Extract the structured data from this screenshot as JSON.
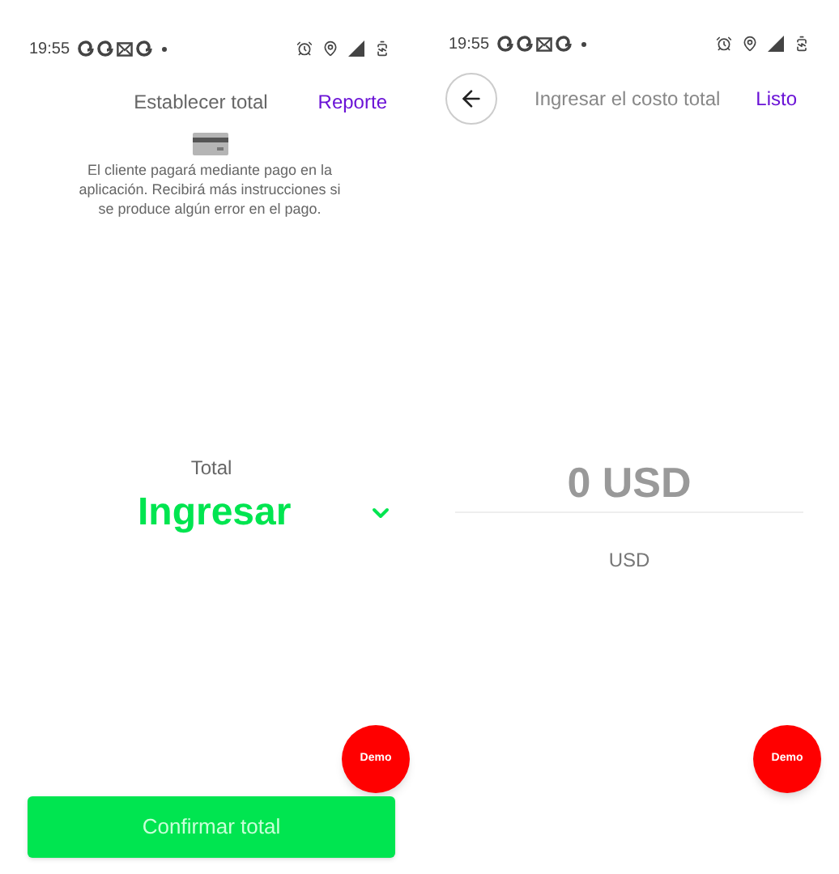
{
  "screens": [
    {
      "status_bar": {
        "time": "19:55"
      },
      "header": {
        "title": "Establecer total",
        "action": "Reporte"
      },
      "info": "El cliente pagará mediante pago en la aplicación. Recibirá más instrucciones si se produce algún error en el pago.",
      "total": {
        "label": "Total",
        "value": "Ingresar"
      },
      "demo_button": "Demo",
      "confirm_button": "Confirmar total"
    },
    {
      "status_bar": {
        "time": "19:55"
      },
      "header": {
        "title": "Ingresar el costo total",
        "action": "Listo"
      },
      "amount": {
        "placeholder": "0 USD",
        "currency": "USD"
      },
      "demo_button": "Demo"
    }
  ]
}
